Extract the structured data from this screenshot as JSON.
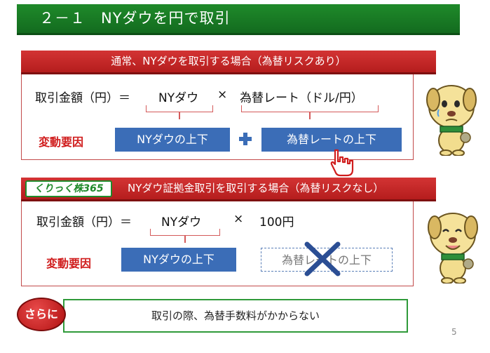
{
  "header": {
    "title": "２－１　NYダウを円で取引"
  },
  "section1": {
    "bar_title": "通常、NYダウを取引する場合（為替リスクあり）",
    "formula": {
      "lhs": "取引金額（円）＝",
      "term1": "NYダウ",
      "op": "×",
      "term2": "為替レート（ドル/円）"
    },
    "factor_label": "変動要因",
    "factor1": "NYダウの上下",
    "plus": "+",
    "factor2": "為替レートの上下"
  },
  "section2": {
    "brand": "くりっく株365",
    "bar_title": "NYダウ証拠金取引を取引する場合（為替リスクなし）",
    "formula": {
      "lhs": "取引金額（円）＝",
      "term1": "NYダウ",
      "op": "×",
      "term2": "100円"
    },
    "factor_label": "変動要因",
    "factor1": "NYダウの上下",
    "factor2_crossed": "為替レートの上下"
  },
  "more": {
    "badge": "さらに",
    "text": "取引の際、為替手数料がかからない"
  },
  "page_number": "5",
  "colors": {
    "header_green": "#1f8a2a",
    "bar_red": "#c52626",
    "factor_blue": "#3b6db7",
    "label_red": "#d01d1d"
  },
  "icons": [
    "dog-mascot-worried-icon",
    "dog-mascot-happy-icon",
    "pointer-hand-icon",
    "cross-mark-icon",
    "plus-icon"
  ]
}
